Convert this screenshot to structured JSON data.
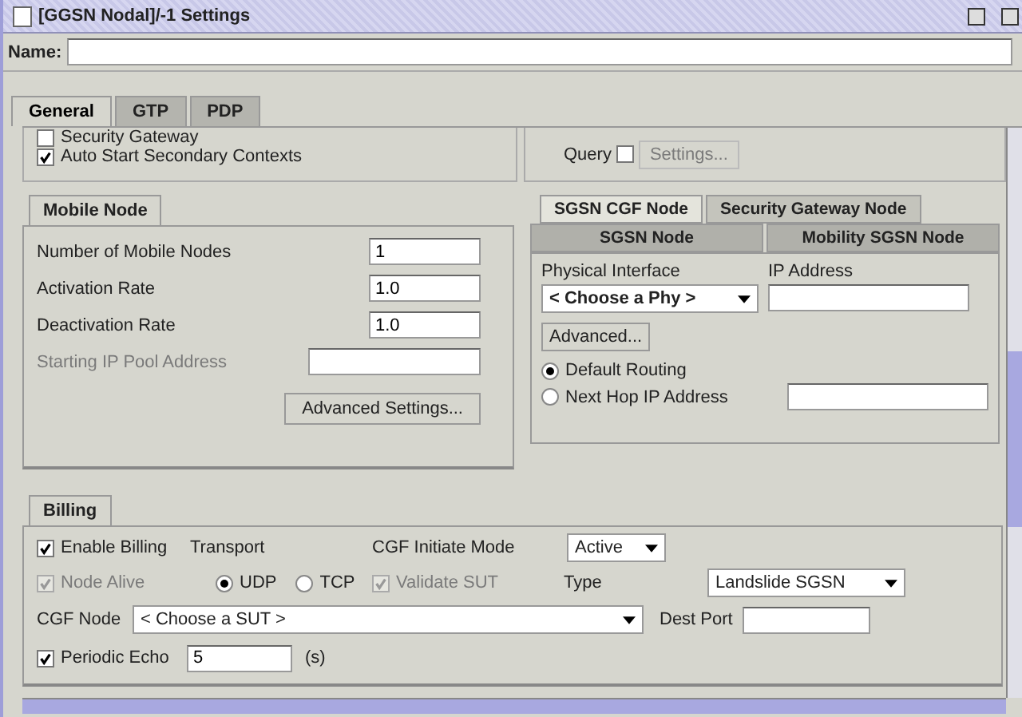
{
  "window": {
    "title": "[GGSN Nodal]/-1 Settings"
  },
  "name_field": {
    "label": "Name:"
  },
  "tabs": [
    {
      "label": "General",
      "selected": true
    },
    {
      "label": "GTP",
      "selected": false
    },
    {
      "label": "PDP",
      "selected": false
    }
  ],
  "general": {
    "top_options": [
      {
        "label": "Security Gateway",
        "checked": false
      },
      {
        "label": "Auto Start Secondary Contexts",
        "checked": true
      }
    ],
    "query": {
      "label": "Query",
      "checked": false
    },
    "settings_button": {
      "label": "Settings...",
      "disabled": true
    },
    "mobile_node": {
      "title": "Mobile Node",
      "fields": [
        {
          "label": "Number of Mobile Nodes",
          "value": "1",
          "disabled": false
        },
        {
          "label": "Activation Rate",
          "value": "1.0",
          "disabled": false
        },
        {
          "label": "Deactivation Rate",
          "value": "1.0",
          "disabled": false
        },
        {
          "label": "Starting IP Pool Address",
          "disabled": true
        }
      ],
      "advanced_button": "Advanced Settings..."
    },
    "node_tabs": [
      [
        {
          "label": "SGSN CGF Node",
          "selected": true
        },
        {
          "label": "Security Gateway Node",
          "selected": false
        }
      ],
      [
        {
          "label": "SGSN Node",
          "selected": false
        },
        {
          "label": "Mobility SGSN Node",
          "selected": false
        }
      ]
    ],
    "interface": {
      "phy_label": "Physical Interface",
      "phy_value": "< Choose a Phy >",
      "ip_label": "IP Address",
      "advanced_button": "Advanced...",
      "routing": [
        {
          "label": "Default Routing",
          "selected": true
        },
        {
          "label": "Next Hop IP Address",
          "selected": false
        }
      ]
    },
    "billing": {
      "title": "Billing",
      "enable": {
        "label": "Enable Billing",
        "checked": true
      },
      "transport_label": "Transport",
      "transport": [
        {
          "label": "UDP",
          "selected": true
        },
        {
          "label": "TCP",
          "selected": false
        }
      ],
      "node_alive": {
        "label": "Node Alive",
        "checked": true,
        "disabled": true
      },
      "validate_sut": {
        "label": "Validate SUT",
        "checked": true,
        "disabled": true
      },
      "cgf_mode_label": "CGF Initiate Mode",
      "cgf_mode": "Active",
      "type_label": "Type",
      "type": "Landslide SGSN",
      "cgf_node_label": "CGF Node",
      "cgf_node": "< Choose a SUT >",
      "dest_port_label": "Dest Port",
      "periodic_echo": {
        "label": "Periodic Echo",
        "checked": true
      },
      "echo_value": "5",
      "echo_unit": "(s)"
    }
  }
}
